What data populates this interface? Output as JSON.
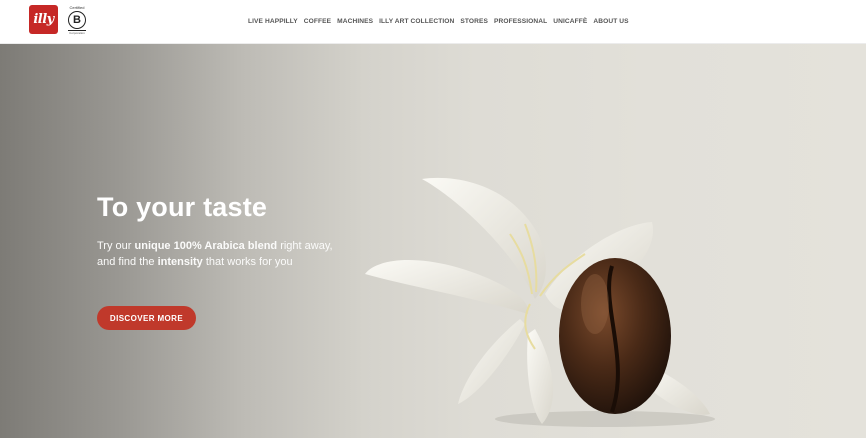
{
  "header": {
    "logo_text": "illy",
    "bcorp": {
      "top_text": "Certified",
      "letter": "B",
      "bottom_text": "Corporation"
    },
    "nav": [
      "LIVE HAPPILLY",
      "COFFEE",
      "MACHINES",
      "ILLY ART COLLECTION",
      "STORES",
      "PROFESSIONAL",
      "UNICAFFÈ",
      "ABOUT US"
    ]
  },
  "hero": {
    "title": "To your taste",
    "text_parts": [
      {
        "text": "Try our ",
        "bold": false
      },
      {
        "text": "unique 100% Arabica blend",
        "bold": true
      },
      {
        "text": " right away, and find the ",
        "bold": false
      },
      {
        "text": "intensity",
        "bold": true
      },
      {
        "text": " that works for you",
        "bold": false
      }
    ],
    "cta_label": "DISCOVER MORE"
  },
  "colors": {
    "brand_red": "#c62826",
    "cta_red": "#c0392b"
  }
}
